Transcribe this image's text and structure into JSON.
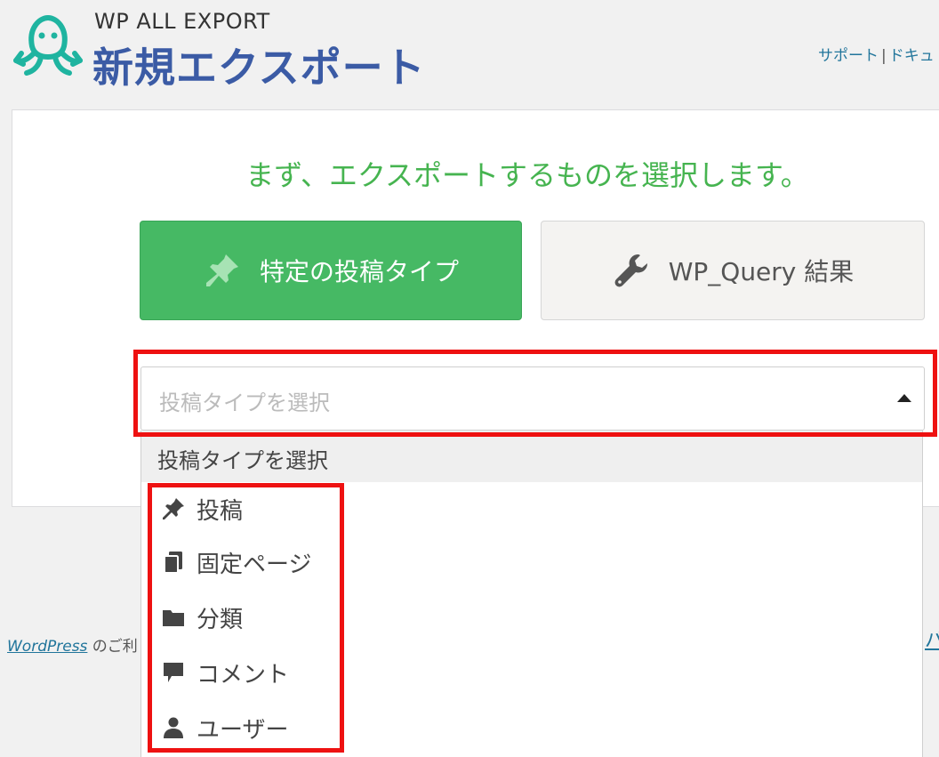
{
  "header": {
    "brand_sub": "WP ALL EXPORT",
    "brand_title": "新規エクスポート",
    "links": [
      "サポート",
      "ドキュ"
    ],
    "link_separator": "|"
  },
  "main": {
    "heading": "まず、エクスポートするものを選択します。",
    "buttons": {
      "specific": "特定の投稿タイプ",
      "wp_query": "WP_Query 結果"
    },
    "select": {
      "placeholder": "投稿タイプを選択"
    },
    "dropdown": {
      "header": "投稿タイプを選択",
      "options": [
        {
          "label": "投稿",
          "icon": "pushpin-icon"
        },
        {
          "label": "固定ページ",
          "icon": "pages-icon"
        },
        {
          "label": "分類",
          "icon": "folder-icon"
        },
        {
          "label": "コメント",
          "icon": "comment-icon"
        },
        {
          "label": "ユーザー",
          "icon": "user-icon"
        }
      ]
    }
  },
  "footer": {
    "link": "WordPress",
    "text": " のご利",
    "right_text": "バ"
  },
  "colors": {
    "accent_green": "#46b964",
    "heading_green": "#46b450",
    "brand_blue": "#3b5ba5",
    "logo_teal": "#1fb4a0",
    "highlight_red": "#ee1111",
    "link_blue": "#21759b"
  }
}
